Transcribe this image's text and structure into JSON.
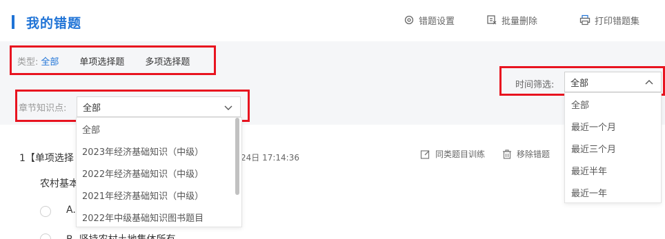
{
  "header": {
    "title": "我的错题",
    "tools": {
      "settings": "错题设置",
      "batch_delete": "批量删除",
      "print": "打印错题集"
    }
  },
  "filters": {
    "type_label": "类型:",
    "types": [
      "全部",
      "单项选择题",
      "多项选择题"
    ],
    "active_type": "全部",
    "chapter_label": "章节知识点:",
    "chapter_value": "全部",
    "chapter_options": [
      "全部",
      "2023年经济基础知识（中级）",
      "2022年经济基础知识（中级）",
      "2021年经济基础知识（中级）",
      "2022年中级基础知识图书题目"
    ],
    "time_label": "时间筛选:",
    "time_value": "全部",
    "time_options": [
      "全部",
      "最近一个月",
      "最近三个月",
      "最近半年",
      "最近一年"
    ]
  },
  "question": {
    "head": "1【单项选择",
    "time": "24日 17:14:36",
    "train_label": "同类题目训练",
    "remove_label": "移除错题",
    "stem": "农村基本",
    "options": [
      "A.",
      "B. 坚持农村土地集体所有"
    ]
  },
  "colors": {
    "accent": "#1f73d6",
    "highlight_box": "#e8131f"
  }
}
